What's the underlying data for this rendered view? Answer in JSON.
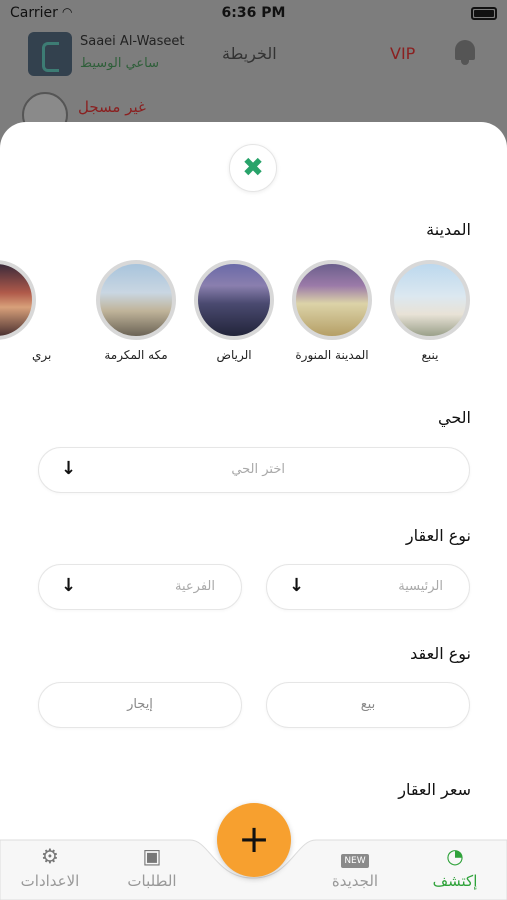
{
  "status_bar": {
    "carrier": "Carrier",
    "time": "6:36 PM"
  },
  "header": {
    "app_name_en": "Saaei Al-Waseet",
    "app_name_ar": "ساعي الوسيط",
    "map_label": "الخريطة",
    "vip_label": "VIP"
  },
  "user": {
    "label": "غير مسجل"
  },
  "filter": {
    "close_icon": "close-icon",
    "city_title": "المدينة",
    "cities": [
      {
        "name": "ينبع"
      },
      {
        "name": "المدينة المنورة"
      },
      {
        "name": "الرياض"
      },
      {
        "name": "مكه المكرمة"
      },
      {
        "name": "بري"
      }
    ],
    "district_title": "الحي",
    "district_placeholder": "اختر الحي",
    "property_type_title": "نوع العقار",
    "main_placeholder": "الرئيسية",
    "sub_placeholder": "الفرعية",
    "contract_type_title": "نوع العقد",
    "contract_sale": "بيع",
    "contract_rent": "إيجار",
    "price_title": "سعر العقار"
  },
  "tabbar": {
    "explore": "إكتشف",
    "new": "الجديدة",
    "new_badge": "NEW",
    "orders": "الطلبات",
    "settings": "الاعدادات",
    "active": "explore",
    "accent_color": "#2fa23a",
    "fab_color": "#f7a02f"
  }
}
